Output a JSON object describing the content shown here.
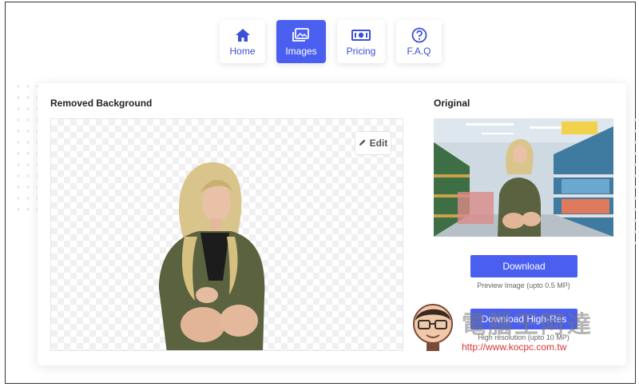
{
  "nav": {
    "items": [
      {
        "label": "Home",
        "icon": "home-icon",
        "active": false
      },
      {
        "label": "Images",
        "icon": "images-icon",
        "active": true
      },
      {
        "label": "Pricing",
        "icon": "banknote-icon",
        "active": false
      },
      {
        "label": "F.A.Q",
        "icon": "question-circle-icon",
        "active": false
      }
    ]
  },
  "result": {
    "removed_title": "Removed Background",
    "edit_label": "Edit",
    "original_title": "Original",
    "download_label": "Download",
    "preview_note": "Preview Image (upto 0.5 MP)",
    "download_hr_label": "Download High-Res",
    "hr_note": "High resolution (upto 10 MP)"
  },
  "watermark": {
    "text": "電腦王阿達",
    "url": "http://www.kocpc.com.tw"
  },
  "colors": {
    "accent": "#4a5ff0",
    "nav_icon": "#3d4fd6"
  }
}
